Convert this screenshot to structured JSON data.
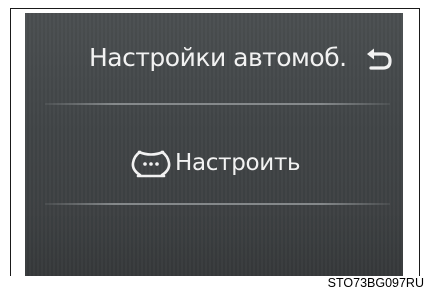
{
  "screen": {
    "title": "Настройки автомоб.",
    "menu_item_label": "Настроить",
    "menu_item_icon": "tire-pressure-icon",
    "back_icon": "back-arrow-icon"
  },
  "caption": "STO73BG097RU",
  "colors": {
    "screen_bg": "#434749",
    "text": "#f2f2f2"
  }
}
